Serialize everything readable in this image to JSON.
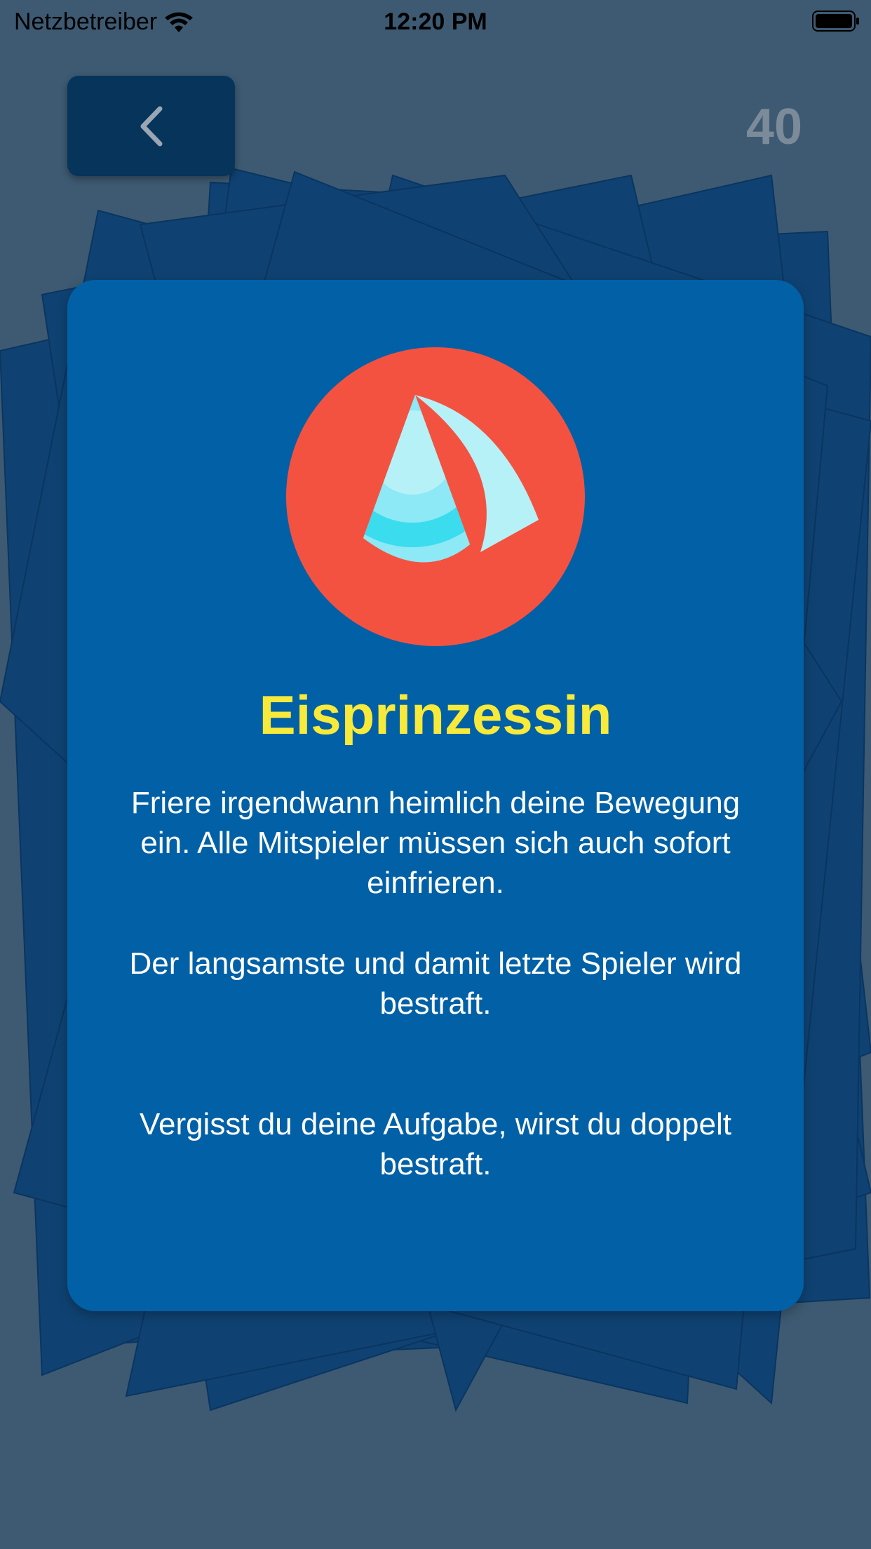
{
  "status_bar": {
    "carrier": "Netzbetreiber",
    "time": "12:20 PM"
  },
  "header": {
    "counter": "40"
  },
  "card": {
    "title": "Eisprinzessin",
    "paragraph_1": "Friere irgendwann heimlich deine Bewegung ein. Alle Mitspieler müssen sich auch sofort einfrieren.",
    "paragraph_2": "Der langsamste und damit letzte Spieler wird bestraft.",
    "paragraph_3": "Vergisst du deine Aufgabe, wirst du doppelt bestraft."
  },
  "colors": {
    "background": "#3d5a72",
    "card": "#0260a6",
    "card_stack": "#0f4272",
    "back_button": "#06345b",
    "title": "#f8ea3a",
    "emblem_circle": "#f45241",
    "emblem_sail_light": "#b7f1f8",
    "emblem_sail_cyan": "#3adcee",
    "counter": "#7c8b99"
  },
  "icons": {
    "back": "chevron-left-icon",
    "emblem": "sailboat-icon",
    "wifi": "wifi-icon",
    "battery": "battery-icon"
  }
}
